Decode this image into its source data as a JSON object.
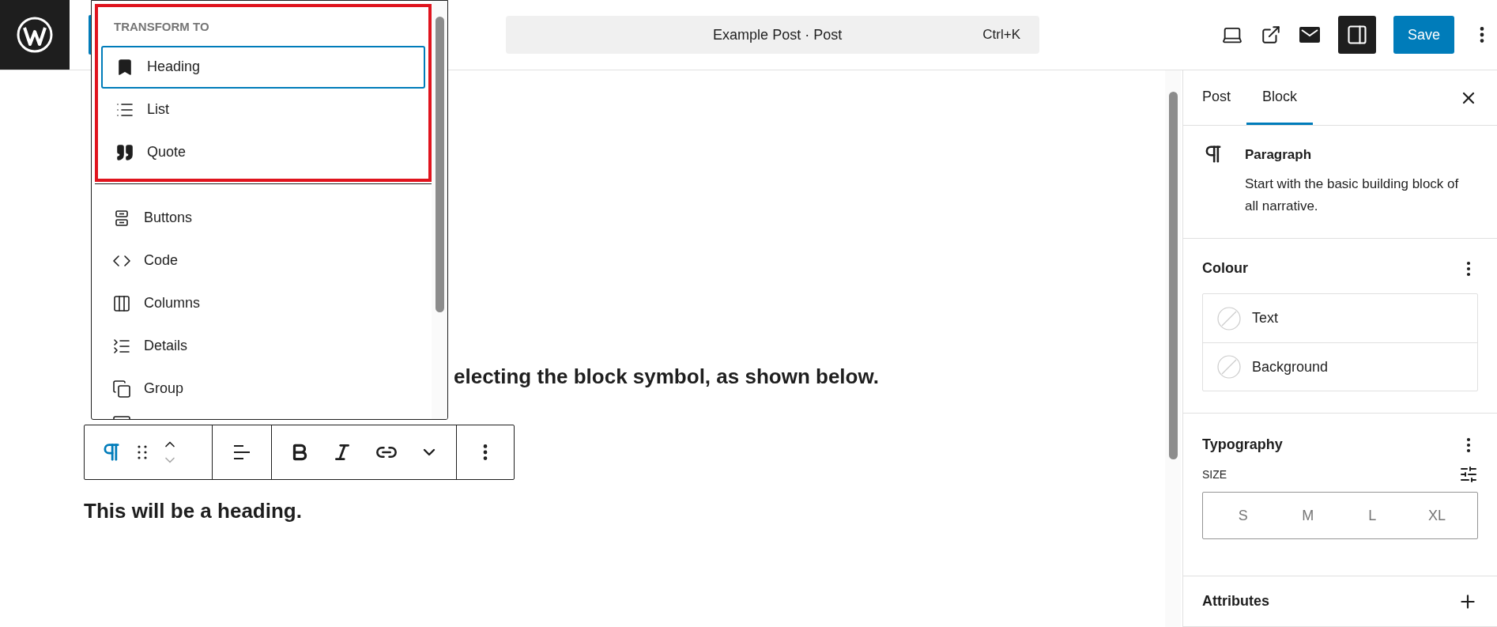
{
  "top_bar": {
    "command_bar": {
      "title": "Example Post · Post",
      "shortcut": "Ctrl+K"
    },
    "sidebar_toggle": {
      "selected": true
    },
    "save_button": "Save"
  },
  "editor": {
    "paragraph_tail": "electing the block symbol, as shown below.",
    "heading_text": "This will be a heading."
  },
  "transform_menu": {
    "heading": "TRANSFORM TO",
    "transform_items": [
      {
        "label": "Heading",
        "selected": true
      },
      {
        "label": "List",
        "selected": false
      },
      {
        "label": "Quote",
        "selected": false
      }
    ],
    "other_items": [
      {
        "label": "Buttons",
        "selected": false
      },
      {
        "label": "Code",
        "selected": false
      },
      {
        "label": "Columns",
        "selected": false
      },
      {
        "label": "Details",
        "selected": false
      },
      {
        "label": "Group",
        "selected": false
      }
    ]
  },
  "sidebar": {
    "tabs": [
      {
        "label": "Post",
        "selected": false
      },
      {
        "label": "Block",
        "selected": true
      }
    ],
    "block_card": {
      "title": "Paragraph",
      "description": "Start with the basic building block of all narrative."
    },
    "colour": {
      "title": "Colour",
      "items": [
        "Text",
        "Background"
      ]
    },
    "typography": {
      "title": "Typography",
      "size_label": "SIZE",
      "sizes": [
        {
          "label": "S",
          "selected": false
        },
        {
          "label": "M",
          "selected": false
        },
        {
          "label": "L",
          "selected": false
        },
        {
          "label": "XL",
          "selected": false
        }
      ]
    },
    "attributes": {
      "title": "Attributes"
    }
  }
}
